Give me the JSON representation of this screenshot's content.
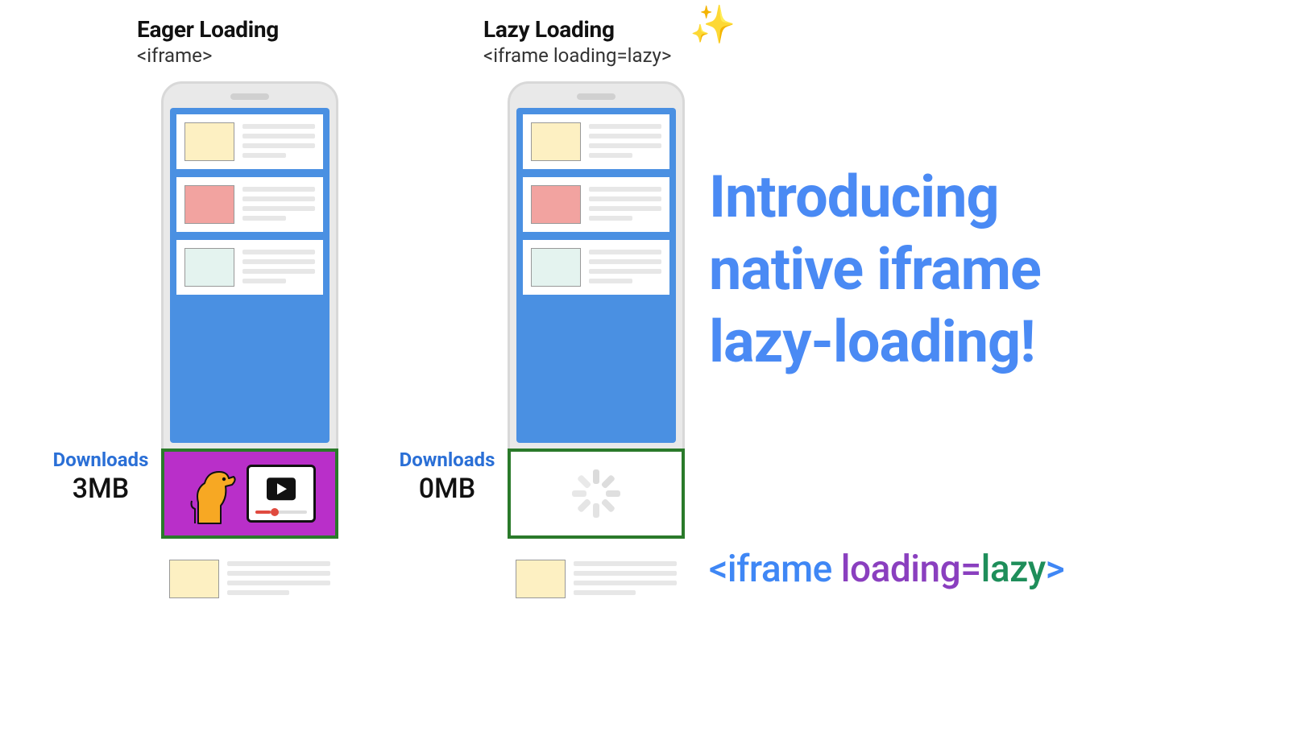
{
  "columns": {
    "eager": {
      "title": "Eager Loading",
      "subtitle": "<iframe>",
      "download_label": "Downloads",
      "download_size": "3MB"
    },
    "lazy": {
      "title": "Lazy Loading",
      "subtitle": "<iframe loading=lazy>",
      "sparkle": "✨",
      "download_label": "Downloads",
      "download_size": "0MB"
    }
  },
  "headline": {
    "line1": "Introducing",
    "line2": "native iframe",
    "line3": "lazy-loading!"
  },
  "code": {
    "open": "<iframe",
    "attr": "loading",
    "eq": "=",
    "val": "lazy",
    "close": ">"
  }
}
